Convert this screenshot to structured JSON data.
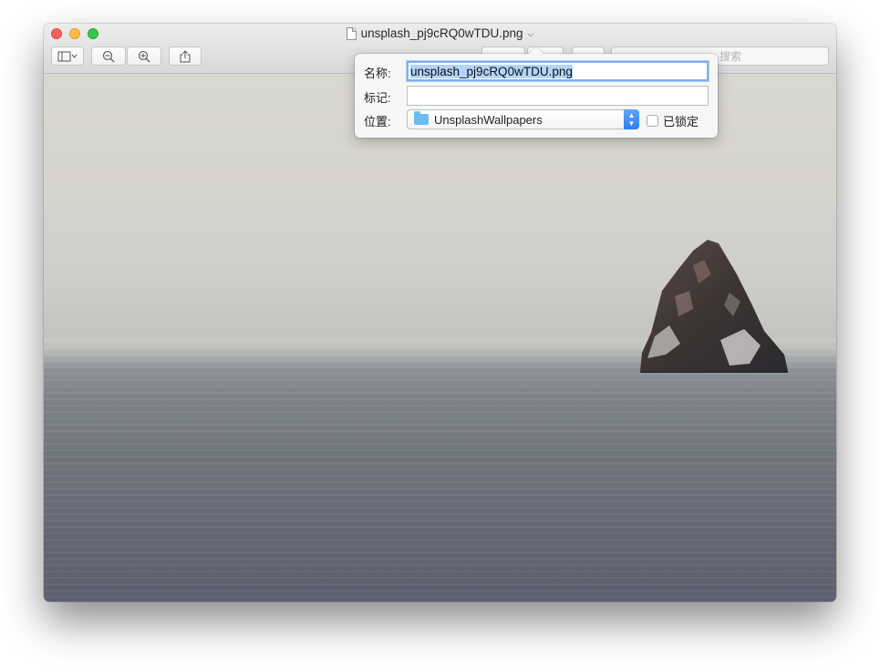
{
  "window": {
    "title": "unsplash_pj9cRQ0wTDU.png",
    "title_menu_icon": "chevron-down-icon",
    "file_icon": "png-file-icon"
  },
  "toolbar": {
    "sidebar_icon": "sidebar-icon",
    "zoom_out_icon": "zoom-out-icon",
    "zoom_in_icon": "zoom-in-icon",
    "share_icon": "share-icon",
    "search_placeholder": "搜索"
  },
  "popover": {
    "name_label": "名称:",
    "name_value": "unsplash_pj9cRQ0wTDU.png",
    "tags_label": "标记:",
    "tags_value": "",
    "location_label": "位置:",
    "location_value": "UnsplashWallpapers",
    "locked_label": "已锁定"
  },
  "colors": {
    "close": "#fc605c",
    "minimize": "#fdbc40",
    "zoom": "#34c84a",
    "selection": "#b3d4fc",
    "accent": "#2c7ef0"
  }
}
